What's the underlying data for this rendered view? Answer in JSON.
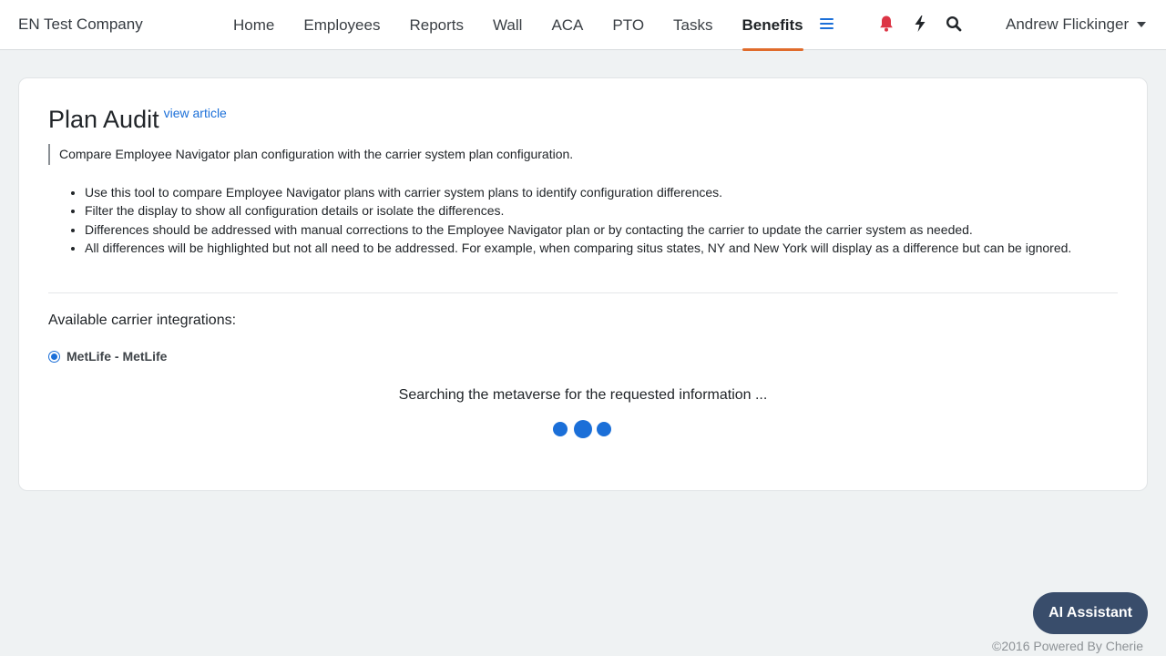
{
  "navbar": {
    "company": "EN Test Company",
    "links": [
      {
        "label": "Home"
      },
      {
        "label": "Employees"
      },
      {
        "label": "Reports"
      },
      {
        "label": "Wall"
      },
      {
        "label": "ACA"
      },
      {
        "label": "PTO"
      },
      {
        "label": "Tasks"
      },
      {
        "label": "Benefits",
        "active": true
      }
    ],
    "user_name": "Andrew Flickinger",
    "icons": [
      "menu-icon",
      "bell-icon",
      "lightning-icon",
      "search-icon"
    ],
    "colors": {
      "active_underline": "#e06b2b",
      "bell": "#dc3545",
      "menu_icon": "#1b6fd8"
    }
  },
  "main": {
    "title": "Plan Audit",
    "view_article": "view article",
    "intro": "Compare Employee Navigator plan configuration with the carrier system plan configuration.",
    "bullets": [
      "Use this tool to compare Employee Navigator plans with carrier system plans to identify configuration differences.",
      "Filter the display to show all configuration details or isolate the differences.",
      "Differences should be addressed with manual corrections to the Employee Navigator plan or by contacting the carrier to update the carrier system as needed.",
      "All differences will be highlighted but not all need to be addressed. For example, when comparing situs states, NY and New York will display as a difference but can be ignored."
    ],
    "integrations_label": "Available carrier integrations:",
    "integrations": [
      {
        "label": "MetLife - MetLife",
        "selected": true
      }
    ],
    "loading_text": "Searching the metaverse for the requested information ..."
  },
  "ai_button": "AI Assistant",
  "footer": "©2016 Powered By Cherie",
  "colors": {
    "accent": "#1b6fd8",
    "ai_button_bg": "#394d6b",
    "page_bg": "#eff2f3"
  }
}
